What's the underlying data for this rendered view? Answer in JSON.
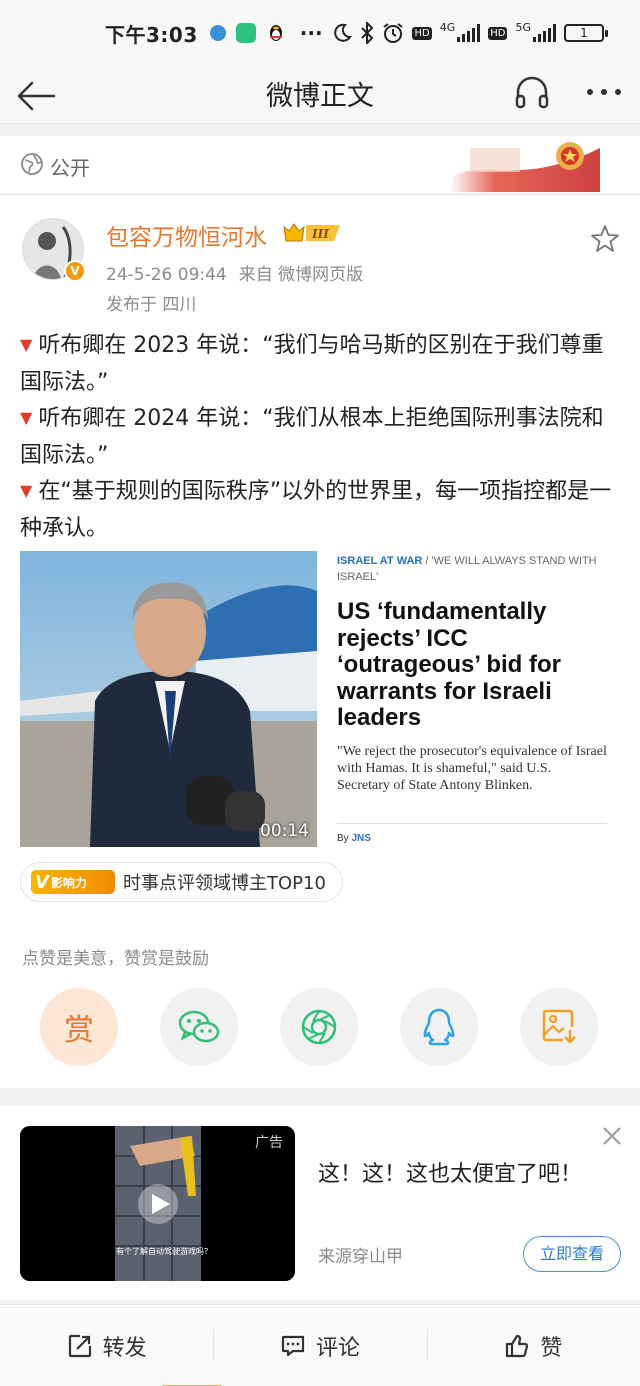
{
  "status_bar": {
    "time": "下午3:03",
    "battery": "1",
    "network_4g": "4G",
    "network_5g": "5G",
    "hd": "HD",
    "more": "···"
  },
  "nav": {
    "title": "微博正文"
  },
  "visibility": {
    "label": "公开"
  },
  "post": {
    "username": "包容万物恒河水",
    "level_badge": "III",
    "timestamp": "24-5-26 09:44",
    "source": "来自 微博网页版",
    "location": "发布于 四川",
    "paragraphs": [
      "听布卿在 2023 年说：“我们与哈马斯的区别在于我们尊重国际法。”",
      "听布卿在 2024 年说：“我们从根本上拒绝国际刑事法院和国际法。”",
      "在“基于规则的国际秩序”以外的世界里，每一项指控都是一种承认。"
    ],
    "video_duration": "00:14",
    "article": {
      "kicker_section": "ISRAEL AT WAR",
      "kicker_rest": " / 'WE WILL ALWAYS STAND WITH ISRAEL'",
      "headline": "US ‘fundamentally rejects’ ICC ‘outrageous’ bid for warrants for Israeli leaders",
      "deck": "\"We reject the prosecutor's equivalence of Israel with Hamas. It is shameful,\" said U.S. Secretary of State Antony Blinken.",
      "byline_prefix": "By ",
      "byline_name": "JNS"
    },
    "influence_badge": "影响力",
    "influence_text": "时事点评领域博主TOP10",
    "reward_hint": "点赞是美意，赞赏是鼓励",
    "reward_label": "赏"
  },
  "ad": {
    "label": "广告",
    "title": "这！这！这也太便宜了吧！",
    "source": "来源穿山甲",
    "cta": "立即查看",
    "caption": "有个了解自动驾驶游戏吗？"
  },
  "toolbar": {
    "repost": "转发",
    "comment": "评论",
    "like": "赞"
  },
  "colors": {
    "accent_orange": "#e8772d",
    "link_blue": "#2e7bd8",
    "wechat_green": "#2fbf77",
    "qq_blue": "#2ea3e6"
  }
}
